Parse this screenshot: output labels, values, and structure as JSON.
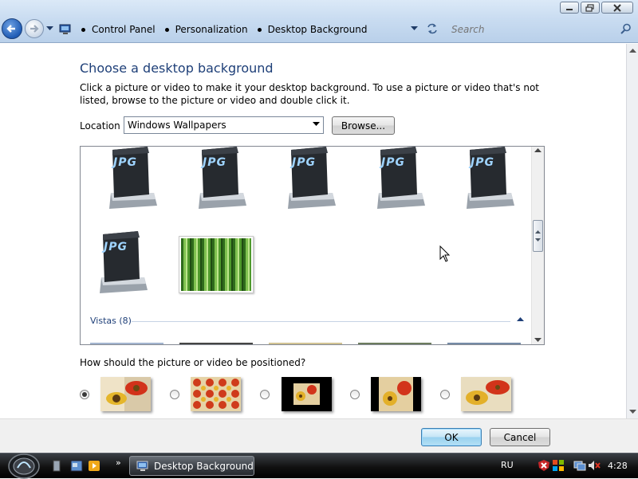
{
  "window": {
    "minimize_icon": "minimize-icon",
    "maximize_icon": "maximize-icon",
    "close_icon": "close-icon"
  },
  "address": {
    "crumbs": [
      "Control Panel",
      "Personalization",
      "Desktop Background"
    ]
  },
  "search": {
    "placeholder": "Search"
  },
  "page": {
    "title": "Choose a desktop background",
    "description": "Click a picture or video to make it your desktop background. To use a picture or video that's not listed, browse to the picture or video and double click it.",
    "location_label": "Location",
    "location_value": "Windows Wallpapers",
    "browse_label": "Browse...",
    "gallery": {
      "jpg_label": "JPG",
      "group_header": "Vistas (8)"
    },
    "position_label": "How should the picture or video be positioned?",
    "position_selected_index": 0
  },
  "footer": {
    "ok_label": "OK",
    "cancel_label": "Cancel"
  },
  "taskbar": {
    "active_window": "Desktop Background",
    "language": "RU",
    "clock": "4:28"
  },
  "colors": {
    "accent": "#1e3f78",
    "ok_button": "#98d1ef"
  }
}
